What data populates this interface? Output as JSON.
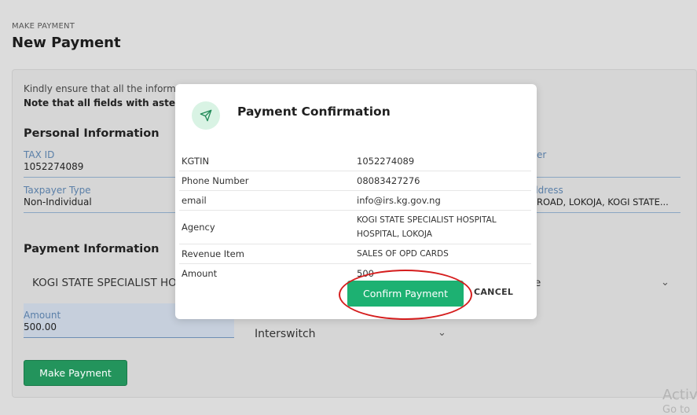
{
  "header": {
    "breadcrumb": "MAKE PAYMENT",
    "title": "New Payment"
  },
  "form": {
    "note_line1": "Kindly ensure that all the inform",
    "note_line2": "Note that all fields with asterisk (",
    "personal_section": "Personal Information",
    "tax_id_label": "TAX ID",
    "tax_id_value": "1052274089",
    "taxpayer_type_label": "Taxpayer Type",
    "taxpayer_type_value": "Non-Individual",
    "right_label_partial1": "er",
    "right_label_partial2": "ddress",
    "address_partial": "ROAD, LOKOJA, KOGI STATE...",
    "payment_section": "Payment Information",
    "agency_select_value": "KOGI STATE SPECIALIST HO",
    "right_select_partial": "e",
    "amount_label": "Amount",
    "amount_value": "500.00",
    "provider_value": "Interswitch",
    "make_payment_label": "Make Payment"
  },
  "modal": {
    "title": "Payment Confirmation",
    "icon": "send-icon",
    "rows": [
      {
        "key": "KGTIN",
        "value": "1052274089"
      },
      {
        "key": "Phone Number",
        "value": "08083427276"
      },
      {
        "key": "email",
        "value": "info@irs.kg.gov.ng"
      },
      {
        "key": "Agency",
        "value": "KOGI STATE SPECIALIST HOSPITAL HOSPITAL, LOKOJA"
      },
      {
        "key": "Revenue Item",
        "value": "SALES OF OPD CARDS"
      },
      {
        "key": "Amount",
        "value": "500"
      }
    ],
    "confirm_label": "Confirm Payment",
    "cancel_label": "CANCEL"
  },
  "watermark": {
    "line1": "Activ",
    "line2": "Go to"
  },
  "colors": {
    "accent_green": "#1db172",
    "highlight_red": "#d51d1d"
  }
}
